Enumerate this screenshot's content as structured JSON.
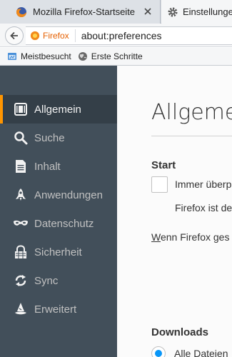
{
  "tabs": [
    {
      "title": "Mozilla Firefox-Startseite",
      "icon": "firefox-icon"
    },
    {
      "title": "Einstellungen",
      "icon": "gear-icon"
    }
  ],
  "navbar": {
    "identity_label": "Firefox",
    "url": "about:preferences"
  },
  "bookmarks": [
    {
      "label": "Meistbesucht",
      "icon": "bookmarks-folder-icon"
    },
    {
      "label": "Erste Schritte",
      "icon": "globe-icon"
    }
  ],
  "sidebar": {
    "items": [
      {
        "label": "Allgemein",
        "icon": "general-icon",
        "selected": true
      },
      {
        "label": "Suche",
        "icon": "search-icon"
      },
      {
        "label": "Inhalt",
        "icon": "content-icon"
      },
      {
        "label": "Anwendungen",
        "icon": "applications-icon"
      },
      {
        "label": "Datenschutz",
        "icon": "privacy-mask-icon"
      },
      {
        "label": "Sicherheit",
        "icon": "security-lock-icon"
      },
      {
        "label": "Sync",
        "icon": "sync-icon"
      },
      {
        "label": "Erweitert",
        "icon": "advanced-wizard-hat-icon"
      }
    ]
  },
  "main": {
    "title": "Allgemein",
    "startup": {
      "heading": "Start",
      "checkbox_label": "Immer überp",
      "checkbox_checked": false,
      "description": "Firefox ist de",
      "when_label_accesskey": "W",
      "when_label_rest": "enn Firefox ges"
    },
    "downloads": {
      "heading": "Downloads",
      "radio_label": "Alle Dateien",
      "radio_selected": true
    }
  },
  "colors": {
    "sidebar_bg": "#424f5a",
    "sidebar_selected_bg": "#343f48",
    "selected_accent": "#ff9500",
    "radio_accent": "#0996f8"
  }
}
